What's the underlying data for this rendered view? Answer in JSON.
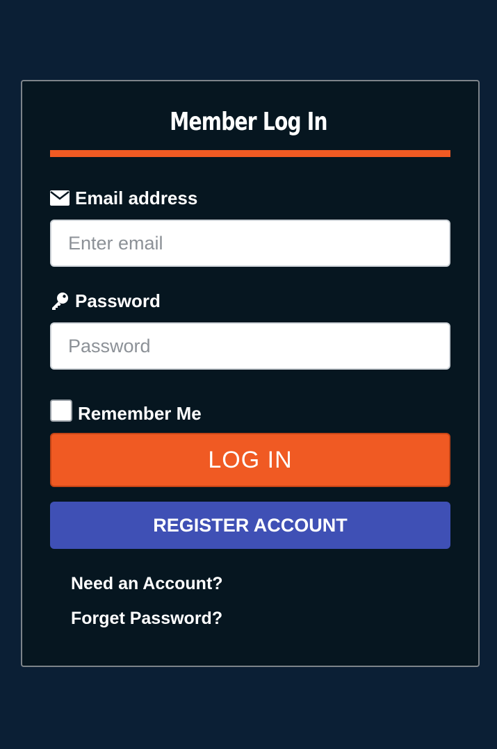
{
  "form": {
    "title": "Member Log In",
    "email": {
      "label": "Email address",
      "placeholder": "Enter email",
      "value": ""
    },
    "password": {
      "label": "Password",
      "placeholder": "Password",
      "value": ""
    },
    "remember": {
      "label": "Remember Me",
      "checked": false
    },
    "login_label": "LOG IN",
    "register_label": "REGISTER ACCOUNT",
    "links": {
      "need_account": "Need an Account?",
      "forget_password": "Forget Password?"
    }
  },
  "colors": {
    "background": "#0b1f35",
    "card": "#061620",
    "accent": "#f05a23",
    "register": "#3f50b5"
  },
  "icons": {
    "email": "envelope-icon",
    "password": "key-icon"
  }
}
